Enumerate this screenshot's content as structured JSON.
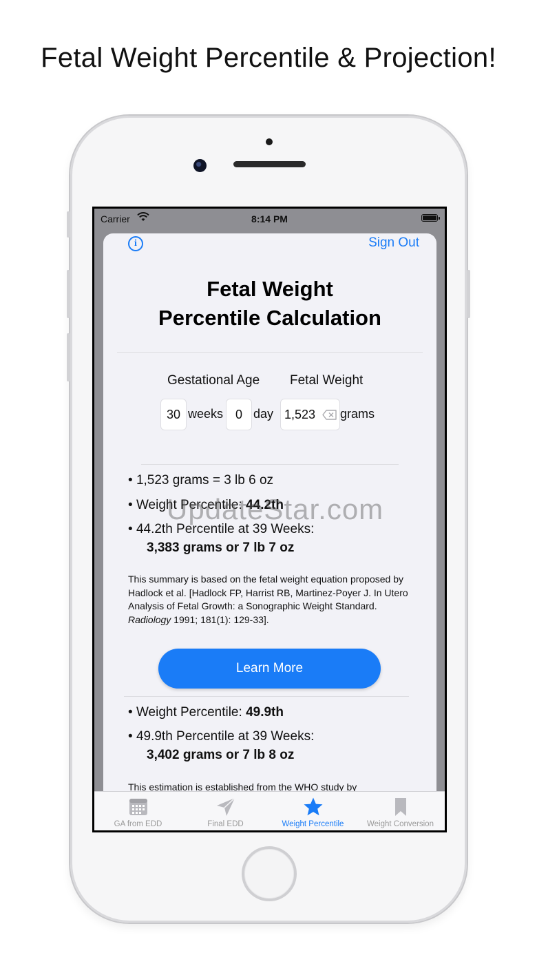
{
  "headline": "Fetal Weight Percentile & Projection!",
  "status_bar": {
    "carrier": "Carrier",
    "time": "8:14 PM"
  },
  "nav": {
    "sign_out": "Sign Out",
    "info_icon": "info-circle-icon"
  },
  "title_line1": "Fetal Weight",
  "title_line2": "Percentile Calculation",
  "inputs": {
    "gestational_age_label": "Gestational Age",
    "fetal_weight_label": "Fetal Weight",
    "weeks_value": "30",
    "weeks_unit": "weeks",
    "days_value": "0",
    "days_unit": "day",
    "weight_value": "1,523",
    "weight_unit": "grams"
  },
  "results_hadlock": {
    "conversion": "1,523 grams = 3 lb 6 oz",
    "percentile_label": "Weight Percentile: ",
    "percentile_value": "44.2th",
    "projection_label": "44.2th Percentile at 39 Weeks:",
    "projection_value": "3,383 grams or 7 lb 7 oz"
  },
  "summary": {
    "text_before": "This summary is based on the fetal weight equation proposed by Hadlock et al. [Hadlock FP, Harrist RB, Martinez-Poyer J. In Utero Analysis of Fetal Growth: a Sonographic Weight Standard. ",
    "journal": "Radiology",
    "text_after": " 1991; 181(1): 129-33]."
  },
  "learn_more": "Learn More",
  "results_who": {
    "percentile_label": "Weight Percentile: ",
    "percentile_value": "49.9th",
    "projection_label": "49.9th Percentile at 39 Weeks:",
    "projection_value": "3,402 grams or 7 lb 8 oz",
    "estimation_text": "This estimation is established from the WHO study by"
  },
  "watermark": "UpdateStar.com",
  "tabs": [
    {
      "label": "GA from EDD",
      "icon": "calendar-icon",
      "active": false
    },
    {
      "label": "Final EDD",
      "icon": "paper-plane-icon",
      "active": false
    },
    {
      "label": "Weight Percentile",
      "icon": "star-icon",
      "active": true
    },
    {
      "label": "Weight Conversion",
      "icon": "bookmark-icon",
      "active": false
    }
  ],
  "colors": {
    "accent": "#1a7cf7",
    "inactive_tab": "#999999",
    "sheet_bg": "#f2f2f7"
  }
}
